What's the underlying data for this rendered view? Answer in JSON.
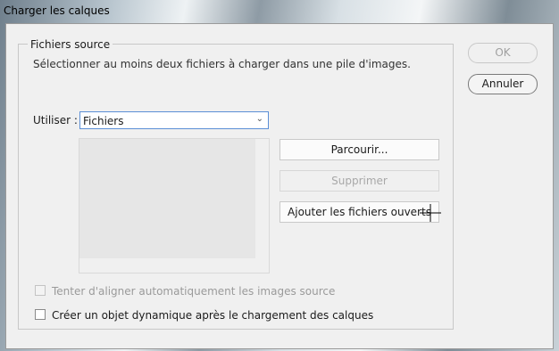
{
  "window": {
    "title": "Charger les calques"
  },
  "source_group": {
    "legend": "Fichiers source",
    "instructions": "Sélectionner au moins deux fichiers à charger dans une pile d'images.",
    "use_label": "Utiliser :",
    "use_value": "Fichiers"
  },
  "buttons": {
    "ok": "OK",
    "cancel": "Annuler",
    "browse": "Parcourir...",
    "remove": "Supprimer",
    "add_open": "Ajouter les fichiers ouverts"
  },
  "options": {
    "auto_align": "Tenter d'aligner automatiquement les images source",
    "smart_object": "Créer un objet dynamique après le chargement des calques"
  }
}
